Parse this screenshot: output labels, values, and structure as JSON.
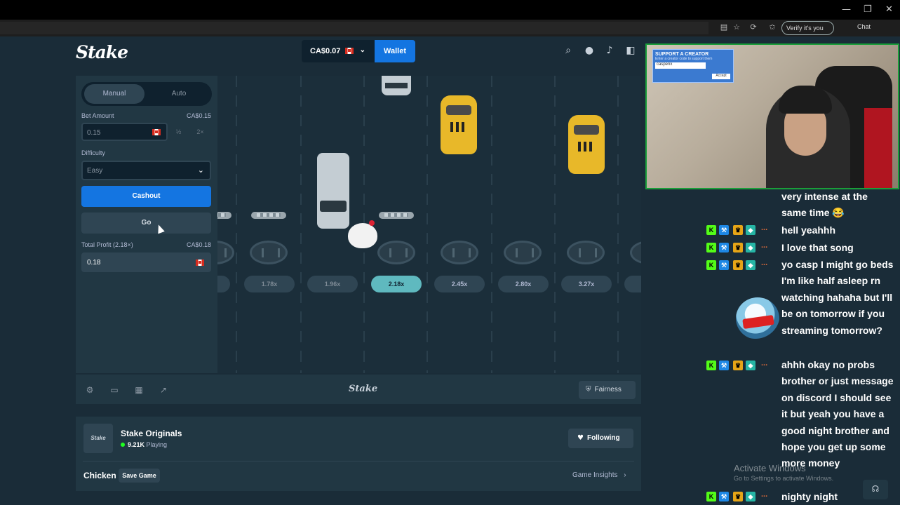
{
  "window": {
    "minimize": "—",
    "restore": "❐",
    "close": "✕"
  },
  "browser": {
    "verify_label": "Verify it's you",
    "chat_label": "Chat",
    "icons": [
      "reader-icon",
      "star-icon",
      "refresh-icon",
      "favorites-icon"
    ]
  },
  "header": {
    "logo": "Stake",
    "balance": "CA$0.07",
    "wallet_label": "Wallet",
    "icons": [
      "search-icon",
      "user-icon",
      "bell-icon",
      "sidebar-icon"
    ]
  },
  "bet_panel": {
    "mode_manual": "Manual",
    "mode_auto": "Auto",
    "bet_amount_label": "Bet Amount",
    "bet_amount_value_display": "CA$0.15",
    "bet_amount_input": "0.15",
    "half_label": "½",
    "double_label": "2×",
    "difficulty_label": "Difficulty",
    "difficulty_value": "Easy",
    "cashout_label": "Cashout",
    "go_label": "Go",
    "total_profit_label": "Total Profit (2.18×)",
    "total_profit_value_display": "CA$0.18",
    "total_profit_input": "0.18"
  },
  "game": {
    "multipliers": [
      "1.78x",
      "1.96x",
      "2.18x",
      "2.45x",
      "2.80x",
      "3.27x"
    ],
    "active_multiplier": "2.18x"
  },
  "toolbar": {
    "logo": "Stake",
    "fairness_label": "Fairness",
    "icons": [
      "settings-icon",
      "theatre-icon",
      "stats-icon",
      "trend-icon"
    ]
  },
  "info": {
    "tile_label": "Stake",
    "title": "Stake Originals",
    "playing_count": "9.21K",
    "playing_label": "Playing",
    "following_label": "Following",
    "game_name": "Chicken",
    "save_game_label": "Save Game",
    "insights_label": "Game Insights"
  },
  "webcam": {
    "card_title": "SUPPORT A CREATOR",
    "card_sub": "Enter a creator code to support them",
    "card_code": "caspenx",
    "card_button": "Accept"
  },
  "chat": {
    "messages": [
      {
        "text": "very intense at the same time 😂",
        "badges": false
      },
      {
        "text": "hell yeahhh",
        "badges": true
      },
      {
        "text": "I love that song",
        "badges": true
      },
      {
        "text": "yo casp I might go beds I'm like half asleep rn watching hahaha but I'll be on tomorrow if you streaming tomorrow?",
        "badges": true
      },
      {
        "text": "ahhh okay no probs brother or just message on discord I should see it but yeah you have a good night brother and hope you get up some more money",
        "badges": true
      },
      {
        "text": "nighty night",
        "badges": true
      }
    ],
    "badge_dots": "...",
    "colors": {
      "badge_k": "#53fc18",
      "badge_hammer": "#1e88e5",
      "badge_crown": "#e6a517",
      "badge_sub": "#26b5a5"
    }
  },
  "os": {
    "activate_title": "Activate Windows",
    "activate_sub": "Go to Settings to activate Windows."
  },
  "colors": {
    "accent_blue": "#1475e1",
    "active_multiplier": "#5fb9bf",
    "background": "#1a2c38",
    "panel": "#213743",
    "webcam_border": "#1a9e3a"
  }
}
